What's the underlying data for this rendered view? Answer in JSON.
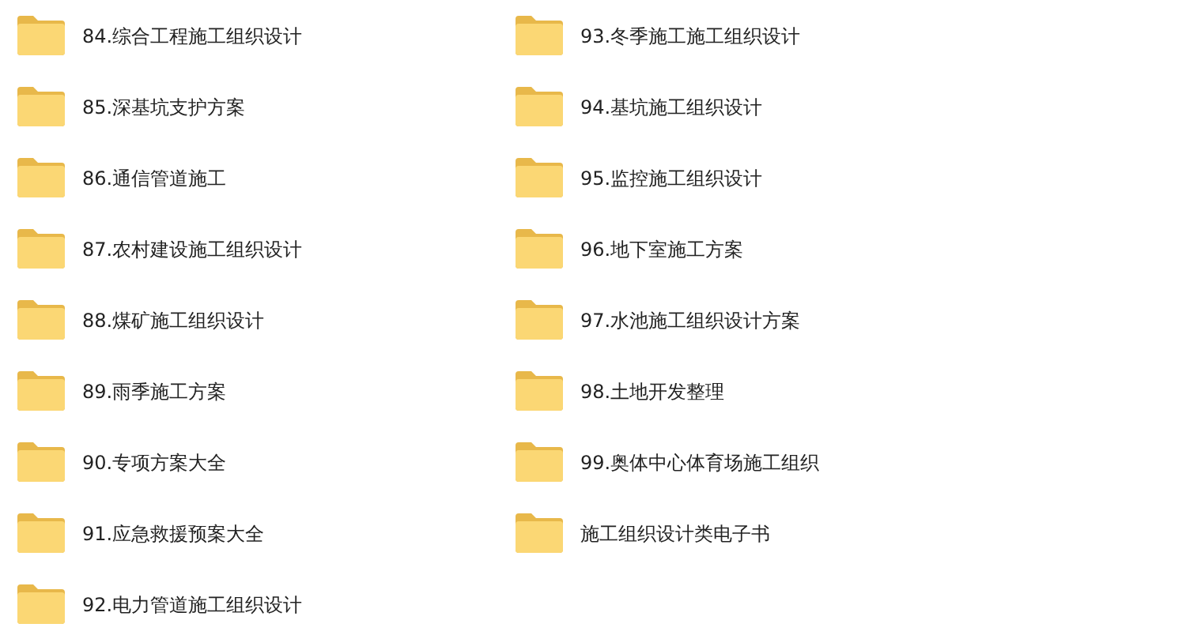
{
  "folders": [
    {
      "name": "84.综合工程施工组织设计"
    },
    {
      "name": "85.深基坑支护方案"
    },
    {
      "name": "86.通信管道施工"
    },
    {
      "name": "87.农村建设施工组织设计"
    },
    {
      "name": "88.煤矿施工组织设计"
    },
    {
      "name": "89.雨季施工方案"
    },
    {
      "name": "90.专项方案大全"
    },
    {
      "name": "91.应急救援预案大全"
    },
    {
      "name": "92.电力管道施工组织设计"
    },
    {
      "name": "93.冬季施工施工组织设计"
    },
    {
      "name": "94.基坑施工组织设计"
    },
    {
      "name": "95.监控施工组织设计"
    },
    {
      "name": "96.地下室施工方案"
    },
    {
      "name": "97.水池施工组织设计方案"
    },
    {
      "name": "98.土地开发整理"
    },
    {
      "name": "99.奥体中心体育场施工组织"
    },
    {
      "name": "施工组织设计类电子书"
    }
  ]
}
